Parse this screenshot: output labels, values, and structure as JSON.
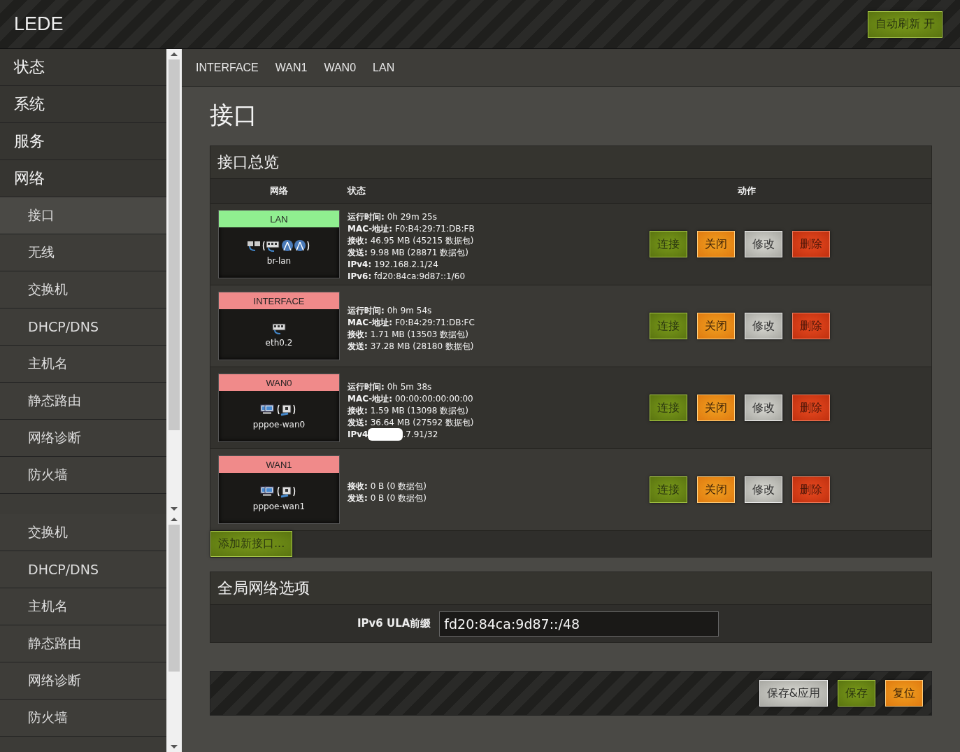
{
  "header": {
    "brand": "LEDE",
    "auto_refresh": "自动刷新 开"
  },
  "sidebar": {
    "panels": [
      {
        "items": [
          {
            "label": "状态"
          },
          {
            "label": "系统"
          },
          {
            "label": "服务"
          },
          {
            "label": "网络",
            "children": [
              {
                "label": "接口",
                "selected": true
              },
              {
                "label": "无线",
                "selected": false
              },
              {
                "label": "交换机",
                "selected": false
              },
              {
                "label": "DHCP/DNS",
                "selected": false
              },
              {
                "label": "主机名",
                "selected": false
              },
              {
                "label": "静态路由",
                "selected": false
              },
              {
                "label": "网络诊断",
                "selected": false
              },
              {
                "label": "防火墙",
                "selected": false
              }
            ]
          }
        ]
      },
      {
        "children": [
          {
            "label": "交换机",
            "selected": false
          },
          {
            "label": "DHCP/DNS",
            "selected": false
          },
          {
            "label": "主机名",
            "selected": false
          },
          {
            "label": "静态路由",
            "selected": false
          },
          {
            "label": "网络诊断",
            "selected": false
          },
          {
            "label": "防火墙",
            "selected": false
          }
        ]
      }
    ]
  },
  "tabs": [
    "INTERFACE",
    "WAN1",
    "WAN0",
    "LAN"
  ],
  "page_title": "接口",
  "overview": {
    "title": "接口总览",
    "columns": [
      "网络",
      "状态",
      "动作"
    ],
    "interfaces": [
      {
        "name": "LAN",
        "color": "#90ee90",
        "kind": "bridge",
        "device": "br-lan",
        "status": [
          {
            "kind": "plain",
            "text": "**运行时间:** 0h 29m 25s"
          },
          {
            "kind": "plain",
            "text": "**MAC-地址:** F0:B4:29:71:DB:FB"
          },
          {
            "kind": "plain",
            "text": "**接收:** 46.95 MB (45215 数据包)"
          },
          {
            "kind": "plain",
            "text": "**发送:** 9.98 MB (28871 数据包)"
          },
          {
            "kind": "plain",
            "text": "**IPv4:** 192.168.2.1/24"
          },
          {
            "kind": "plain",
            "text": "**IPv6:** fd20:84ca:9d87::1/60"
          }
        ],
        "actions": [
          {
            "label": "连接",
            "kind": "connect"
          },
          {
            "label": "关闭",
            "kind": "close"
          },
          {
            "label": "修改",
            "kind": "edit"
          },
          {
            "label": "删除",
            "kind": "delete"
          }
        ]
      },
      {
        "name": "INTERFACE",
        "color": "#f08a8a",
        "kind": "ethernet",
        "device": "eth0.2",
        "status": [
          {
            "kind": "plain",
            "text": "**运行时间:** 0h 9m 54s"
          },
          {
            "kind": "plain",
            "text": "**MAC-地址:** F0:B4:29:71:DB:FC"
          },
          {
            "kind": "plain",
            "text": "**接收:** 1.71 MB (13503 数据包)"
          },
          {
            "kind": "plain",
            "text": "**发送:** 37.28 MB (28180 数据包)"
          }
        ],
        "actions": [
          {
            "label": "连接",
            "kind": "connect"
          },
          {
            "label": "关闭",
            "kind": "close"
          },
          {
            "label": "修改",
            "kind": "edit"
          },
          {
            "label": "删除",
            "kind": "delete"
          }
        ]
      },
      {
        "name": "WAN0",
        "color": "#f08a8a",
        "kind": "pppoe",
        "device": "pppoe-wan0",
        "status": [
          {
            "kind": "plain",
            "text": "**运行时间:** 0h 5m 38s"
          },
          {
            "kind": "plain",
            "text": "**MAC-地址:** 00:00:00:00:00:00"
          },
          {
            "kind": "plain",
            "text": "**接收:** 1.59 MB (13098 数据包)"
          },
          {
            "kind": "plain",
            "text": "**发送:** 36.64 MB (27592 数据包)"
          },
          {
            "kind": "masked",
            "text": "**IPv4**",
            "tail": ".7.91/32"
          }
        ],
        "actions": [
          {
            "label": "连接",
            "kind": "connect"
          },
          {
            "label": "关闭",
            "kind": "close"
          },
          {
            "label": "修改",
            "kind": "edit"
          },
          {
            "label": "删除",
            "kind": "delete"
          }
        ]
      },
      {
        "name": "WAN1",
        "color": "#f08a8a",
        "kind": "pppoe",
        "device": "pppoe-wan1",
        "status": [
          {
            "kind": "plain",
            "text": "**接收:** 0 B (0 数据包)"
          },
          {
            "kind": "plain",
            "text": "**发送:** 0 B (0 数据包)"
          }
        ],
        "actions": [
          {
            "label": "连接",
            "kind": "connect"
          },
          {
            "label": "关闭",
            "kind": "close"
          },
          {
            "label": "修改",
            "kind": "edit"
          },
          {
            "label": "删除",
            "kind": "delete"
          }
        ]
      }
    ],
    "add_button": "添加新接口..."
  },
  "global": {
    "title": "全局网络选项",
    "field_label": "IPv6 ULA前缀",
    "field_value": "fd20:84ca:9d87::/48"
  },
  "footer_buttons": [
    {
      "label": "保存&应用",
      "kind": "edit"
    },
    {
      "label": "保存",
      "kind": "connect"
    },
    {
      "label": "复位",
      "kind": "close"
    }
  ]
}
